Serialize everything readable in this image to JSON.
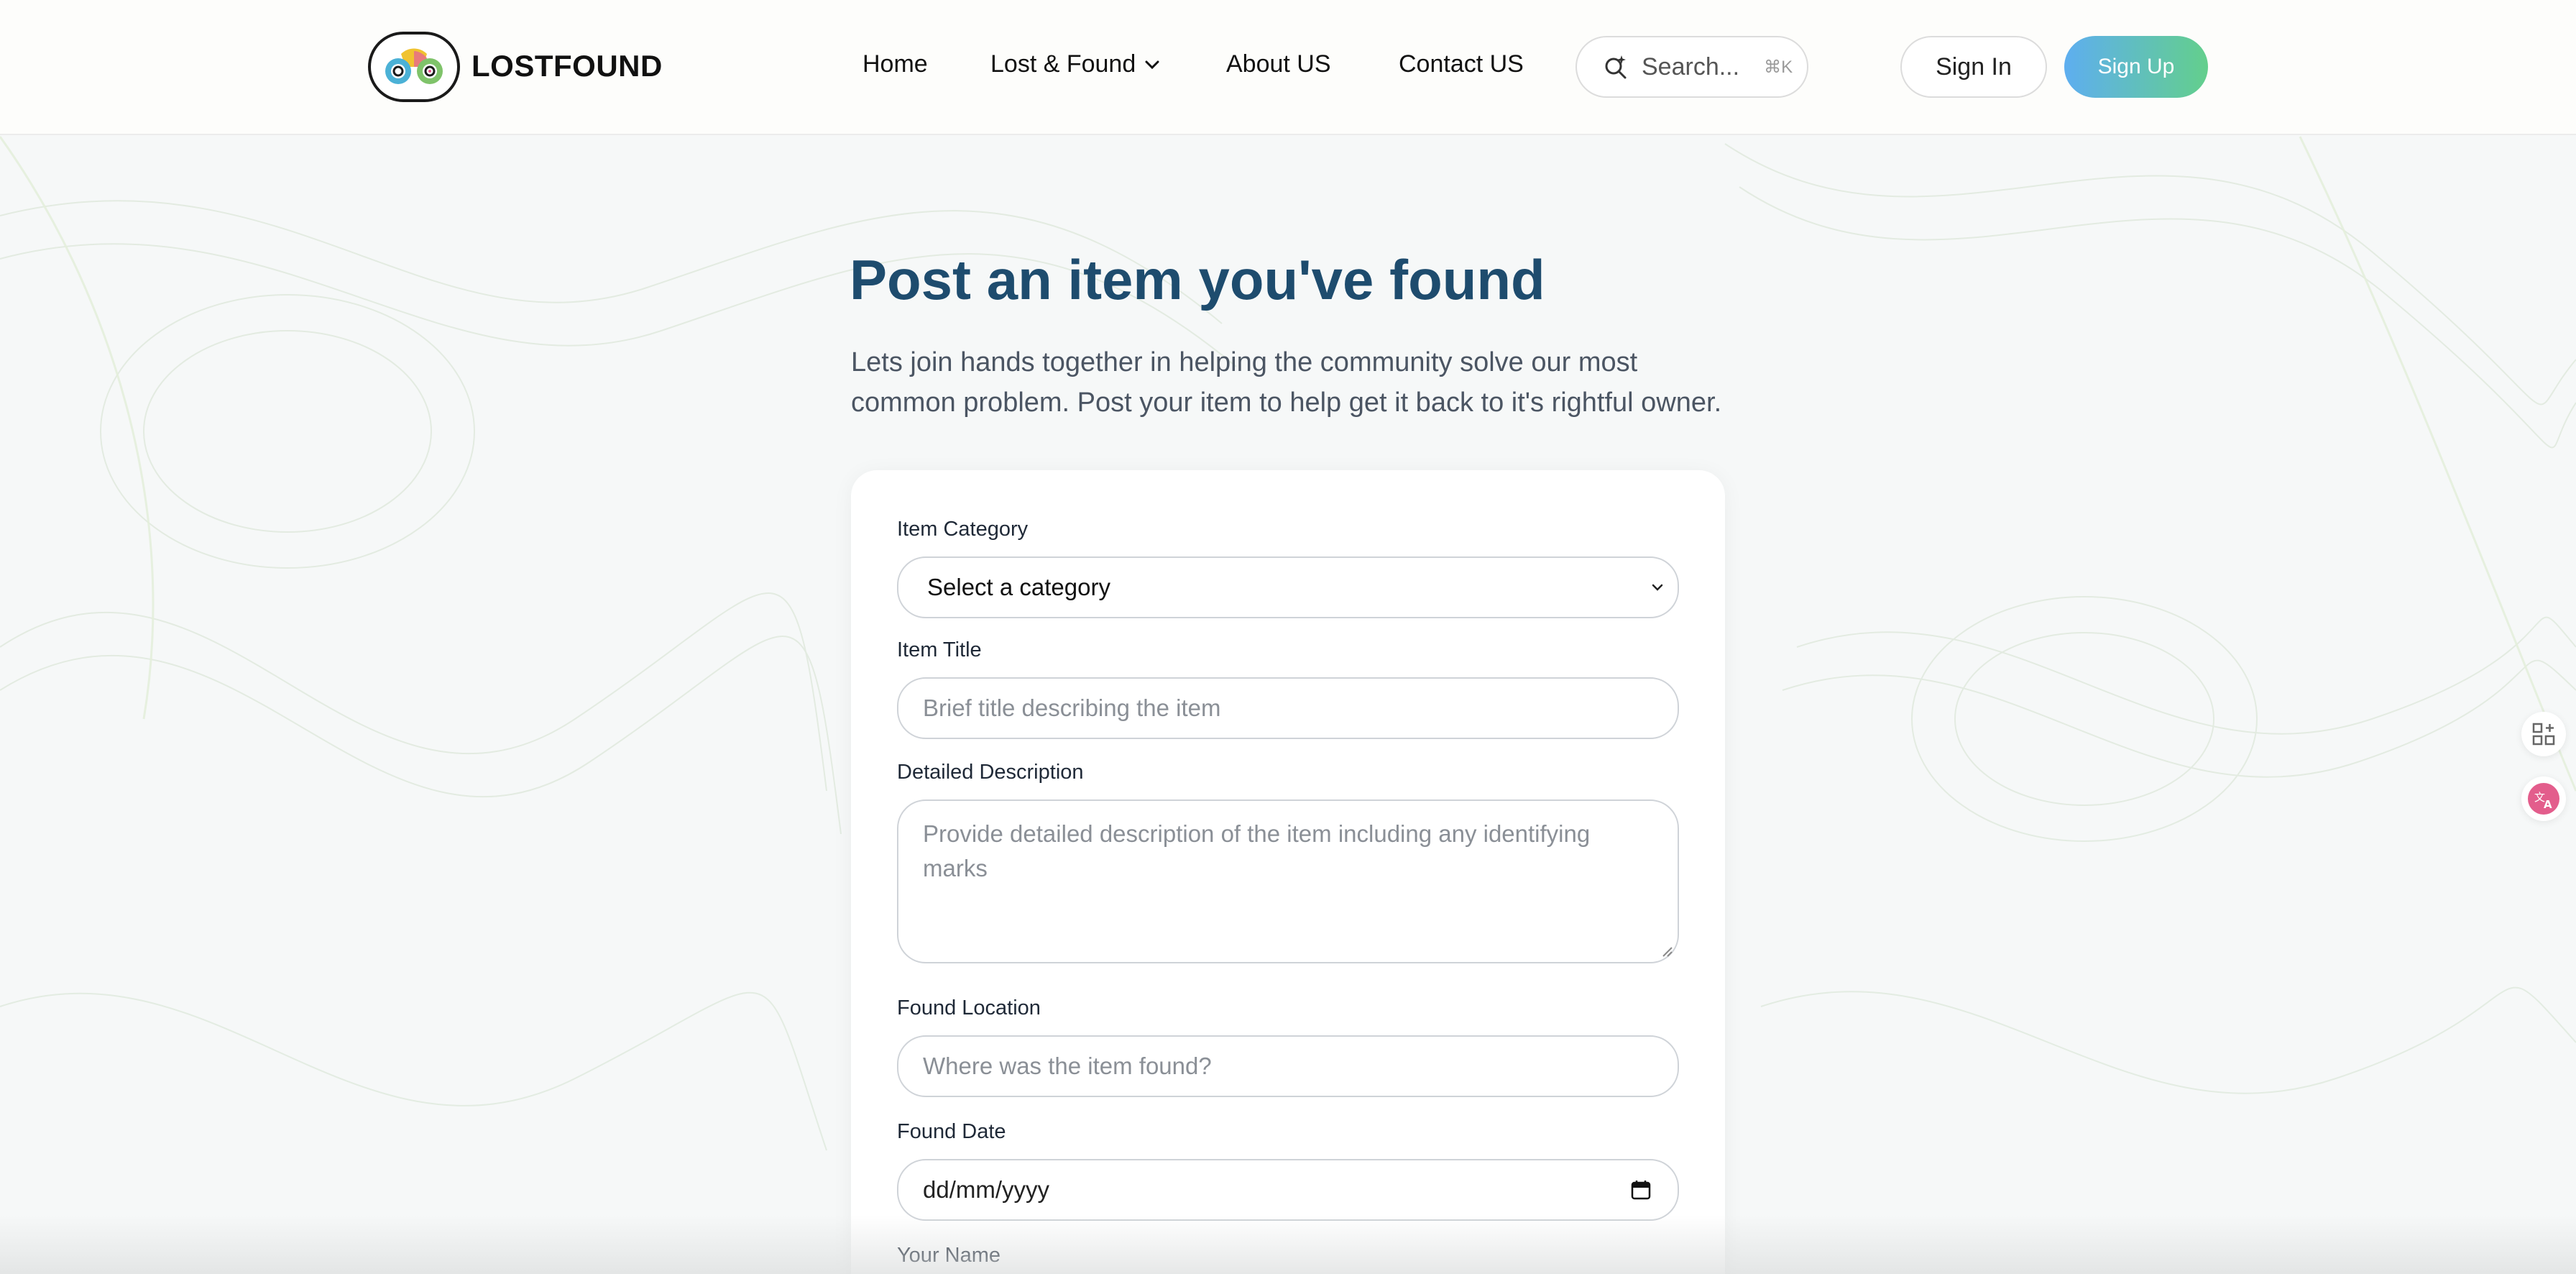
{
  "header": {
    "brand": "LOSTFOUND",
    "nav": {
      "home": "Home",
      "lost_found": "Lost & Found",
      "about": "About US",
      "contact": "Contact US"
    },
    "search": {
      "placeholder": "Search...",
      "shortcut": "⌘K"
    },
    "sign_in": "Sign In",
    "sign_up": "Sign Up"
  },
  "hero": {
    "title": "Post an item you've found",
    "subtitle": "Lets join hands together in helping the community solve our most common problem. Post your item to help get it back to it's rightful owner."
  },
  "form": {
    "category_label": "Item Category",
    "category_value": "Select a category",
    "title_label": "Item Title",
    "title_placeholder": "Brief title describing the item",
    "description_label": "Detailed Description",
    "description_placeholder": "Provide detailed description of the item including any identifying marks",
    "location_label": "Found Location",
    "location_placeholder": "Where was the item found?",
    "date_label": "Found Date",
    "date_placeholder": "dd/mm/yyyy",
    "name_label": "Your Name"
  },
  "icons": {
    "logo": "binoculars-logo-icon",
    "nav_dropdown": "chevron-down-icon",
    "search": "search-sparkle-icon",
    "select_arrow": "chevron-down-icon",
    "calendar": "calendar-icon",
    "side_1": "apps-add-icon",
    "side_2": "translate-icon"
  },
  "colors": {
    "title": "#1e4c6e",
    "sign_up_gradient_start": "#5eaef0",
    "sign_up_gradient_end": "#63cf8c",
    "translate_icon": "#e35d8c"
  }
}
